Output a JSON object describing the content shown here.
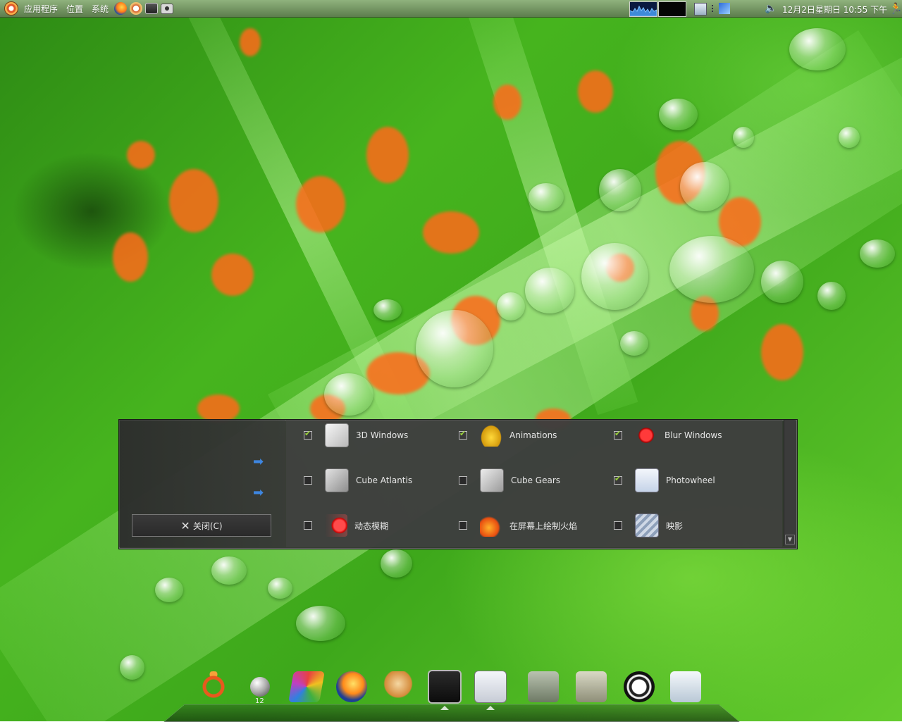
{
  "top_panel": {
    "menus": [
      "应用程序",
      "位置",
      "系统"
    ],
    "launchers": [
      "firefox-icon",
      "help-icon",
      "terminal-icon",
      "screenshot-icon"
    ],
    "applets": [
      "cpu-graph",
      "network-graph",
      "update-notifier-icon",
      "network-icon",
      "volume-icon"
    ],
    "clock": "12月2日星期日 10:55 下午"
  },
  "dialog": {
    "close_label": "关闭(C)",
    "plugins": [
      {
        "label": "3D Windows",
        "checked": true,
        "icon": "3d-windows-icon"
      },
      {
        "label": "Animations",
        "checked": true,
        "icon": "animations-icon"
      },
      {
        "label": "Blur Windows",
        "checked": true,
        "icon": "blur-windows-icon"
      },
      {
        "label": "Cube Atlantis",
        "checked": false,
        "icon": "cube-atlantis-icon"
      },
      {
        "label": "Cube Gears",
        "checked": false,
        "icon": "cube-gears-icon"
      },
      {
        "label": "Photowheel",
        "checked": true,
        "icon": "photowheel-icon"
      },
      {
        "label": "动态模糊",
        "checked": false,
        "icon": "motion-blur-icon"
      },
      {
        "label": "在屏幕上绘制火焰",
        "checked": false,
        "icon": "fire-icon"
      },
      {
        "label": "映影",
        "checked": false,
        "icon": "reflection-icon"
      }
    ]
  },
  "dock": {
    "items": [
      "ubuntu-icon",
      "ball-icon",
      "colors-icon",
      "firefox-icon",
      "mail-icon",
      "terminal-icon",
      "preferences-icon",
      "download-icon",
      "folder-icon",
      "power-icon",
      "trash-icon"
    ],
    "ball_label": "12"
  }
}
